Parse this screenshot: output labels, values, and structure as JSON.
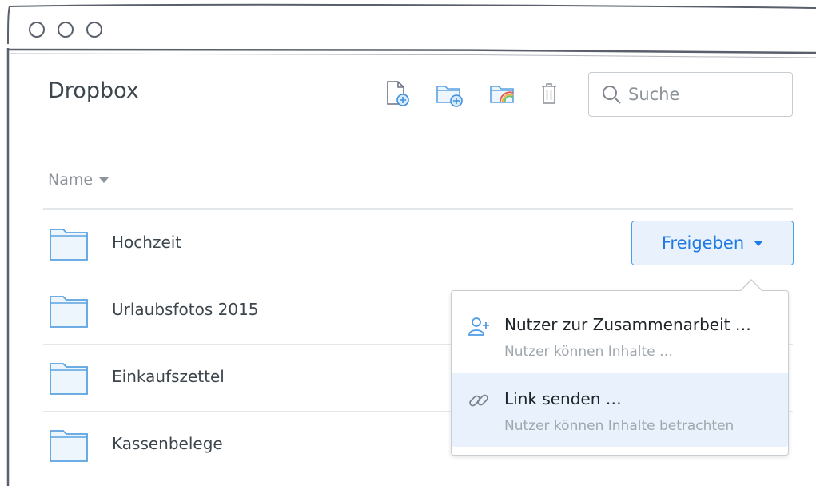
{
  "app": {
    "title": "Dropbox"
  },
  "toolbar": {
    "icons": [
      "new-file-icon",
      "new-folder-icon",
      "shared-folder-icon",
      "trash-icon"
    ]
  },
  "search": {
    "placeholder": "Suche",
    "value": ""
  },
  "list": {
    "column_header": "Name",
    "rows": [
      {
        "name": "Hochzeit",
        "icon": "folder-icon"
      },
      {
        "name": "Urlaubsfotos 2015",
        "icon": "folder-icon"
      },
      {
        "name": "Einkaufszettel",
        "icon": "folder-icon"
      },
      {
        "name": "Kassenbelege",
        "icon": "folder-icon"
      }
    ]
  },
  "share": {
    "button_label": "Freigeben",
    "menu": [
      {
        "label": "Nutzer zur Zusammenarbeit …",
        "sub": "Nutzer können Inhalte …",
        "icon": "add-user-icon"
      },
      {
        "label": "Link senden …",
        "sub": "Nutzer können Inhalte betrachten",
        "icon": "link-icon"
      }
    ]
  },
  "colors": {
    "accent": "#1f7ae3",
    "accent_bg": "#e9f2fc",
    "text": "#3d464d",
    "muted": "#8c939a",
    "folder_stroke": "#5aa2e0",
    "folder_fill": "#eef6fd"
  }
}
